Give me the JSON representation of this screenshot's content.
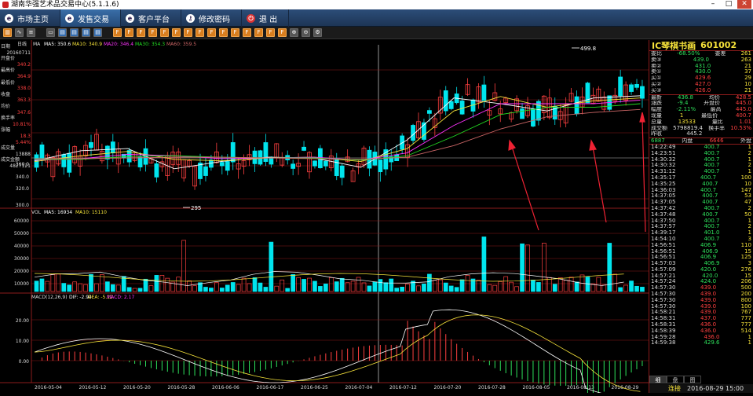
{
  "window": {
    "title": "湖南华强艺术品交易中心(5.1.1.6)"
  },
  "nav": [
    {
      "label": "市场主页",
      "icon": "globe-icon",
      "active": false
    },
    {
      "label": "发售交易",
      "icon": "globe-icon",
      "active": true
    },
    {
      "label": "客户平台",
      "icon": "globe-icon",
      "active": false
    },
    {
      "label": "修改密码",
      "icon": "key-icon",
      "active": false
    },
    {
      "label": "退 出",
      "icon": "power-icon",
      "active": false
    }
  ],
  "toolbar_icons": [
    "kline-icon",
    "line-icon",
    "mode-icon",
    "F1",
    "F2",
    "F3",
    "F4",
    "F5",
    "F6",
    "F7",
    "F8",
    "F9",
    "F10",
    "F11",
    "F12",
    "F13",
    "F14",
    "F15",
    "F16",
    "zoom-in-icon",
    "zoom-out-icon",
    "settings-icon"
  ],
  "legend": {
    "ma": [
      "MA",
      "MA5: 350.6",
      "MA10: 340.9",
      "MA20: 346.4",
      "MA30: 354.3",
      "MA60: 359.5"
    ],
    "period": "日线",
    "vol": [
      "VOL",
      "MA5: 16934",
      "MA10: 15110"
    ],
    "macd": [
      "MACD(12,26,9)",
      "DIF: -2.94",
      "DEA: -5.12",
      "MACD: 2.17"
    ]
  },
  "info_panel": [
    {
      "label": "日期",
      "value": "20160711"
    },
    {
      "label": "开盘价",
      "value": "340.2"
    },
    {
      "label": "最高价",
      "value": "364.9"
    },
    {
      "label": "最低价",
      "value": "338.0"
    },
    {
      "label": "收盘",
      "value": "363.3"
    },
    {
      "label": "均价",
      "value": "347.6"
    },
    {
      "label": "换手率",
      "value": "10.81%"
    },
    {
      "label": "涨幅",
      "value": "18.3"
    },
    {
      "label": "",
      "value": "5.44%"
    },
    {
      "label": "成交量",
      "value": "13888"
    },
    {
      "label": "成交金额",
      "value": "4827121"
    }
  ],
  "price_labels": {
    "peak": "499.8",
    "trough": "295"
  },
  "y_axis_price": [
    "360.0",
    "340.0",
    "320.0",
    "300.0"
  ],
  "y_axis_vol": [
    "60000",
    "50000",
    "40000",
    "30000",
    "20000",
    "10000"
  ],
  "y_axis_macd": [
    "20.00",
    "10.00",
    "0.00"
  ],
  "x_axis": [
    "2016-05-04",
    "2016-05-12",
    "2016-05-20",
    "2016-05-28",
    "2016-06-06",
    "2016-06-17",
    "2016-06-25",
    "2016-07-04",
    "2016-07-12",
    "2016-07-20",
    "2016-07-28",
    "2016-08-05",
    "2016-08-13",
    "2016-08-29"
  ],
  "stock": {
    "name": "IC琴棋书画",
    "code": "601002"
  },
  "quote_top": [
    {
      "l": "委比",
      "v": "-68.50%",
      "l2": "委差",
      "v2": "261"
    },
    {
      "l": "卖③",
      "v": "439.0",
      "v2": "263"
    },
    {
      "l": "卖②",
      "v": "431.0",
      "v2": "21"
    },
    {
      "l": "卖①",
      "v": "430.0",
      "v2": "37"
    },
    {
      "l": "买①",
      "v": "429.6",
      "v2": "29"
    },
    {
      "l": "买②",
      "v": "427.0",
      "v2": "10"
    },
    {
      "l": "买③",
      "v": "426.0",
      "v2": "21"
    }
  ],
  "quote_mid": [
    {
      "l": "最新",
      "v": "436.8",
      "l2": "均价",
      "v2": "428.5"
    },
    {
      "l": "涨跌",
      "v": "-9.4",
      "l2": "开盘价",
      "v2": "445.0"
    },
    {
      "l": "幅度",
      "v": "-2.11%",
      "l2": "最高",
      "v2": "445.0"
    },
    {
      "l": "现量",
      "v": "1",
      "l2": "最低价",
      "v2": "400.7"
    },
    {
      "l": "总量",
      "v": "13533",
      "l2": "量比",
      "v2": "1.01"
    },
    {
      "l": "成交额",
      "v": "5798819.4",
      "l2": "换手率",
      "v2": "10.53%"
    },
    {
      "l": "昨收",
      "v": "445.2",
      "l2": "",
      "v2": ""
    }
  ],
  "in_out": {
    "outer_label": "外盘",
    "outer": "6646",
    "inner_label": "内盘",
    "inner": "6887"
  },
  "ticks": [
    [
      "14:22:49",
      "400.7",
      "1"
    ],
    [
      "14:23:51",
      "400.7",
      "2"
    ],
    [
      "14:30:32",
      "400.7",
      "1"
    ],
    [
      "14:30:32",
      "400.7",
      "2"
    ],
    [
      "14:31:12",
      "400.7",
      "1"
    ],
    [
      "14:35:17",
      "400.7",
      "100"
    ],
    [
      "14:35:25",
      "400.7",
      "10"
    ],
    [
      "14:36:03",
      "400.7",
      "147"
    ],
    [
      "14:37:05",
      "400.7",
      "53"
    ],
    [
      "14:37:05",
      "400.7",
      "47"
    ],
    [
      "14:37:42",
      "400.7",
      "2"
    ],
    [
      "14:37:48",
      "400.7",
      "50"
    ],
    [
      "14:37:50",
      "400.7",
      "1"
    ],
    [
      "14:37:57",
      "400.7",
      "2"
    ],
    [
      "14:39:17",
      "401.0",
      "1"
    ],
    [
      "14:54:10",
      "400.7",
      "3"
    ],
    [
      "14:56:51",
      "406.9",
      "110"
    ],
    [
      "14:56:51",
      "406.9",
      "15"
    ],
    [
      "14:56:51",
      "406.9",
      "125"
    ],
    [
      "14:57:03",
      "406.9",
      "3"
    ],
    [
      "14:57:09",
      "420.0",
      "276"
    ],
    [
      "14:57:21",
      "420.0",
      "15"
    ],
    [
      "14:57:24",
      "424.0",
      "206"
    ],
    [
      "14:57:30",
      "439.0",
      "500"
    ],
    [
      "14:57:30",
      "439.0",
      "200"
    ],
    [
      "14:57:30",
      "439.0",
      "800"
    ],
    [
      "14:57:30",
      "439.0",
      "100"
    ],
    [
      "14:58:21",
      "439.0",
      "767"
    ],
    [
      "14:58:31",
      "437.0",
      "777"
    ],
    [
      "14:58:31",
      "436.0",
      "777"
    ],
    [
      "14:58:39",
      "436.0",
      "514"
    ],
    [
      "14:59:28",
      "436.0",
      "1"
    ],
    [
      "14:59:38",
      "429.6",
      "1"
    ]
  ],
  "side_tabs": [
    "细",
    "盘",
    "图"
  ],
  "status": {
    "conn": "连接",
    "datetime": "2016-08-29 15:00"
  },
  "colors": {
    "up": "#ff4040",
    "down": "#00e5ee",
    "grid": "#8b1b1b",
    "ma5": "#ffffff",
    "ma10": "#f6e33a",
    "ma20": "#ff33ff",
    "ma30": "#22dd22",
    "ma60": "#cc6666"
  },
  "chart_data": {
    "type": "candlestick",
    "x": [
      "2016-05-04",
      "2016-05-12",
      "2016-05-20",
      "2016-05-28",
      "2016-06-06",
      "2016-06-17",
      "2016-06-25",
      "2016-07-04",
      "2016-07-12",
      "2016-07-20",
      "2016-07-28",
      "2016-08-05",
      "2016-08-13",
      "2016-08-29"
    ],
    "series": [
      {
        "name": "MA5",
        "values": [
          331,
          345,
          348,
          320,
          330,
          336,
          335,
          322,
          360,
          418,
          410,
          400,
          418,
          421
        ]
      },
      {
        "name": "MA10",
        "values": [
          330,
          338,
          344,
          333,
          331,
          335,
          336,
          330,
          348,
          400,
          420,
          405,
          414,
          418
        ]
      },
      {
        "name": "MA20",
        "values": [
          332,
          334,
          340,
          338,
          334,
          335,
          336,
          332,
          342,
          380,
          410,
          410,
          410,
          415
        ]
      },
      {
        "name": "MA30",
        "values": [
          333,
          333,
          337,
          338,
          336,
          335,
          335,
          332,
          338,
          365,
          395,
          405,
          405,
          410
        ]
      },
      {
        "name": "MA60",
        "values": [
          334,
          334,
          335,
          336,
          336,
          335,
          334,
          333,
          336,
          352,
          375,
          392,
          398,
          402
        ]
      }
    ],
    "ylim": [
      290,
      500
    ]
  }
}
